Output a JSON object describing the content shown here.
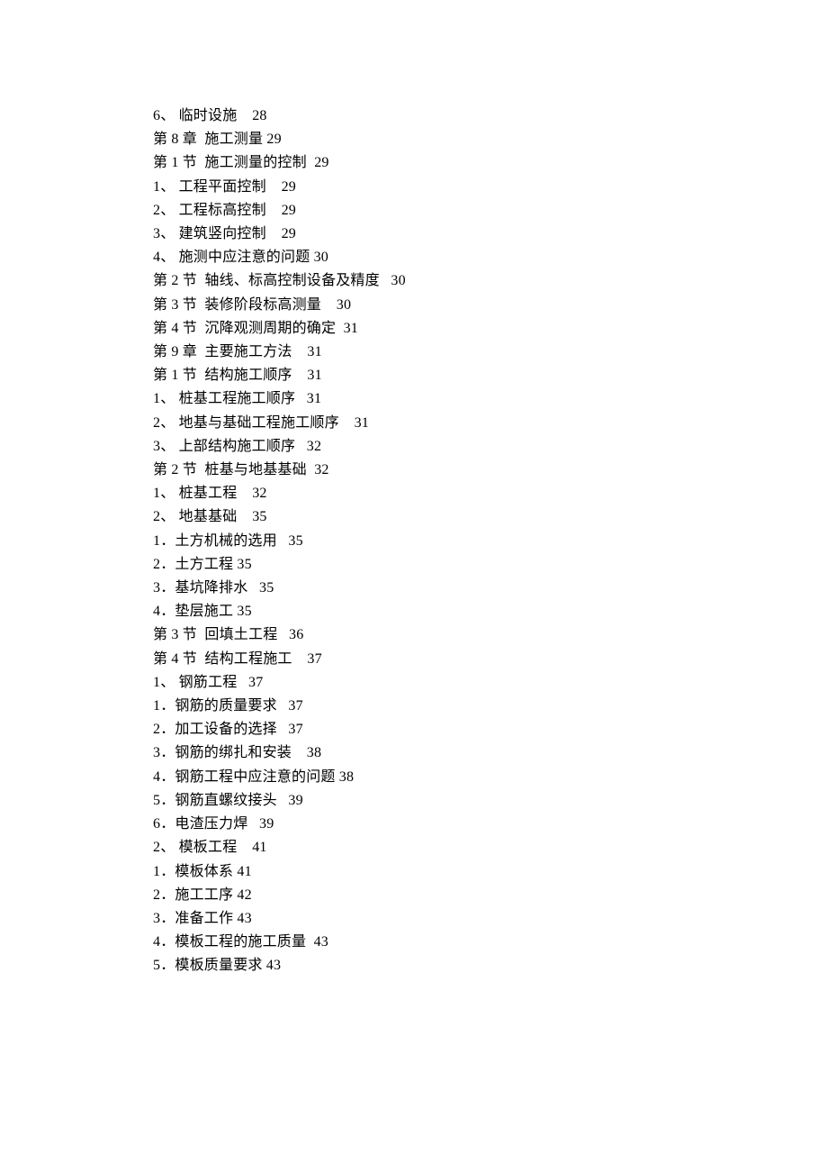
{
  "lines": [
    "6、 临时设施    28",
    "第 8 章  施工测量 29",
    "第 1 节  施工测量的控制  29",
    "1、 工程平面控制    29",
    "2、 工程标高控制    29",
    "3、 建筑竖向控制    29",
    "4、 施测中应注意的问题 30",
    "第 2 节  轴线、标高控制设备及精度   30",
    "第 3 节  装修阶段标高测量    30",
    "第 4 节  沉降观测周期的确定  31",
    "第 9 章  主要施工方法    31",
    "第 1 节  结构施工顺序    31",
    "1、 桩基工程施工顺序   31",
    "2、 地基与基础工程施工顺序    31",
    "3、 上部结构施工顺序   32",
    "第 2 节  桩基与地基基础  32",
    "1、 桩基工程    32",
    "2、 地基基础    35",
    "1．土方机械的选用   35",
    "2．土方工程 35",
    "3．基坑降排水   35",
    "4．垫层施工 35",
    "第 3 节  回填土工程   36",
    "第 4 节  结构工程施工    37",
    "1、 钢筋工程   37",
    "1．钢筋的质量要求   37",
    "2．加工设备的选择   37",
    "3．钢筋的绑扎和安装    38",
    "4．钢筋工程中应注意的问题 38",
    "5．钢筋直螺纹接头   39",
    "6．电渣压力焊   39",
    "2、 模板工程    41",
    "1．模板体系 41",
    "2．施工工序 42",
    "3．准备工作 43",
    "4．模板工程的施工质量  43",
    "5．模板质量要求 43"
  ]
}
